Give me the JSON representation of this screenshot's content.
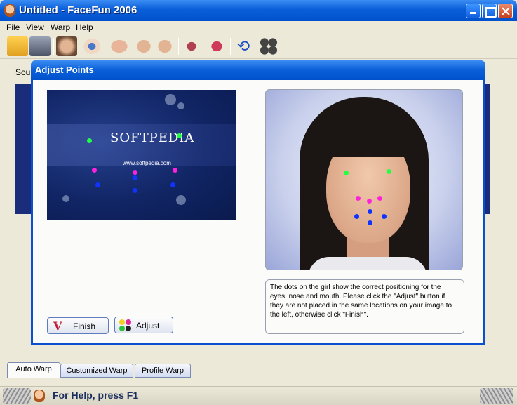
{
  "window": {
    "title": "Untitled - FaceFun 2006"
  },
  "menu": [
    "File",
    "View",
    "Warp",
    "Help"
  ],
  "toolbar": {
    "tools": [
      "open-folder",
      "save-disk",
      "face",
      "eye",
      "nose",
      "face-left",
      "face-right",
      "lips-closed",
      "lips-open",
      "rotate",
      "dots"
    ]
  },
  "workarea": {
    "source_label": "Sour"
  },
  "dialog": {
    "title": "Adjust Points",
    "source_image": {
      "logo_text": "SOFTPEDIA",
      "url_text": "www.softpedia.com"
    },
    "info_text": "The dots on the girl show the correct positioning for the eyes, nose and mouth. Please click the \"Adjust\" button if they are not placed in the same locations on your image to the left, otherwise click \"Finish\".",
    "finish_label": "Finish",
    "adjust_label": "Adjust"
  },
  "tabs": [
    "Auto Warp",
    "Customized Warp",
    "Profile Warp"
  ],
  "active_tab": "Auto Warp",
  "statusbar": {
    "text": "For Help, press F1"
  },
  "colors": {
    "title_blue": "#0a5fd8",
    "eye_point": "#22ff44",
    "nose_point": "#ff22dd",
    "mouth_point": "#1133ff"
  }
}
